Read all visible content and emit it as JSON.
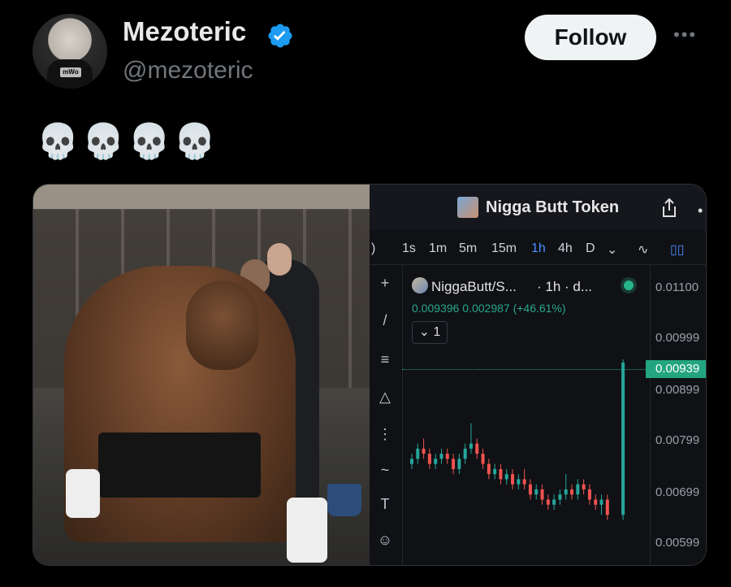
{
  "post": {
    "author_name": "Mezoteric",
    "author_handle": "@mezoteric",
    "follow_label": "Follow",
    "more_label": "•••",
    "text": "💀💀💀💀"
  },
  "chart_panel": {
    "title": "Nigga Butt Token",
    "timeframes": [
      "1s",
      "1m",
      "5m",
      "15m",
      "1h",
      "4h",
      "D"
    ],
    "active_timeframe": "1h",
    "symbol_label": "NiggaButt/S...",
    "symbol_meta": "· 1h · d...",
    "ohlc_text": "0.009396  0.002987 (+46.61%)",
    "volume_button": "⌄ 1",
    "current_price": "0.00939",
    "price_axis": [
      "0.01100",
      "0.00999",
      "0.00899",
      "0.00799",
      "0.00699",
      "0.00599"
    ],
    "accent_up": "#26a69a",
    "accent_down": "#ef5350"
  },
  "chart_data": {
    "type": "candlestick",
    "ylim": [
      0.0059,
      0.0112
    ],
    "candles": [
      [
        0.0074,
        0.0076,
        0.0073,
        0.0075
      ],
      [
        0.0075,
        0.0078,
        0.0074,
        0.0077
      ],
      [
        0.0077,
        0.0079,
        0.0075,
        0.0076
      ],
      [
        0.0076,
        0.0077,
        0.0073,
        0.0074
      ],
      [
        0.0074,
        0.0076,
        0.0073,
        0.0075
      ],
      [
        0.0075,
        0.0077,
        0.0074,
        0.0076
      ],
      [
        0.0076,
        0.0077,
        0.0074,
        0.0075
      ],
      [
        0.0075,
        0.0076,
        0.0072,
        0.0073
      ],
      [
        0.0073,
        0.0076,
        0.0072,
        0.0075
      ],
      [
        0.0075,
        0.0078,
        0.0074,
        0.0077
      ],
      [
        0.0077,
        0.0082,
        0.0076,
        0.0078
      ],
      [
        0.0078,
        0.0079,
        0.0075,
        0.0076
      ],
      [
        0.0076,
        0.0077,
        0.0073,
        0.0074
      ],
      [
        0.0074,
        0.0075,
        0.0071,
        0.0072
      ],
      [
        0.0072,
        0.0074,
        0.0071,
        0.0073
      ],
      [
        0.0073,
        0.0074,
        0.007,
        0.0071
      ],
      [
        0.0071,
        0.0073,
        0.007,
        0.0072
      ],
      [
        0.0072,
        0.0073,
        0.0069,
        0.007
      ],
      [
        0.007,
        0.0072,
        0.0069,
        0.0071
      ],
      [
        0.0071,
        0.0073,
        0.0069,
        0.007
      ],
      [
        0.007,
        0.0071,
        0.0067,
        0.0068
      ],
      [
        0.0068,
        0.007,
        0.0067,
        0.0069
      ],
      [
        0.0069,
        0.007,
        0.0066,
        0.0067
      ],
      [
        0.0067,
        0.0068,
        0.0065,
        0.0066
      ],
      [
        0.0066,
        0.0068,
        0.0065,
        0.0067
      ],
      [
        0.0067,
        0.0069,
        0.0066,
        0.0068
      ],
      [
        0.0068,
        0.0072,
        0.0067,
        0.0069
      ],
      [
        0.0069,
        0.007,
        0.0067,
        0.0068
      ],
      [
        0.0068,
        0.0071,
        0.0067,
        0.007
      ],
      [
        0.007,
        0.0071,
        0.0068,
        0.0069
      ],
      [
        0.0069,
        0.007,
        0.0066,
        0.0067
      ],
      [
        0.0067,
        0.0068,
        0.0065,
        0.0066
      ],
      [
        0.0066,
        0.0068,
        0.0064,
        0.0067
      ],
      [
        0.0067,
        0.0068,
        0.0063,
        0.0064
      ],
      [
        0.0064,
        0.00945,
        0.0063,
        0.00939
      ]
    ]
  }
}
